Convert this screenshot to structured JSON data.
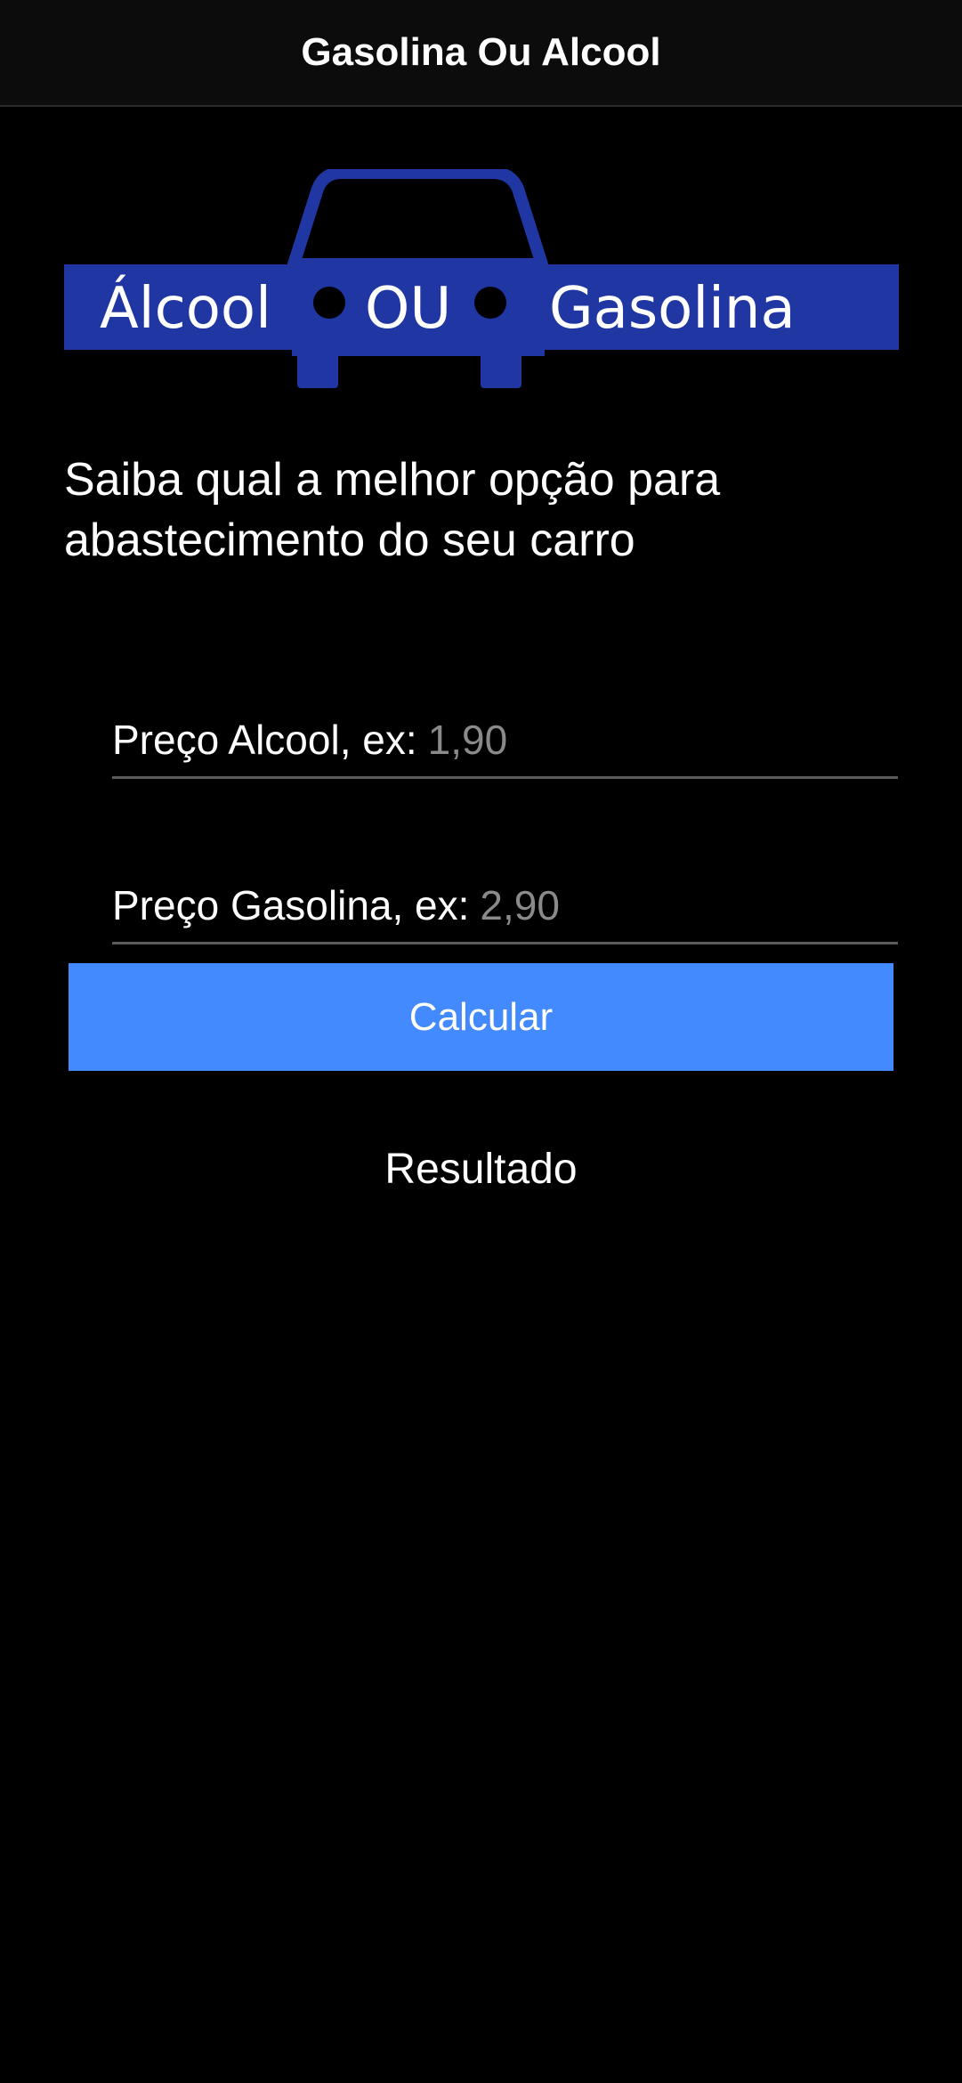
{
  "app_bar": {
    "title": "Gasolina Ou Alcool"
  },
  "logo": {
    "left_text": "Álcool",
    "middle_text": "OU",
    "right_text": "Gasolina",
    "color": "#1f36a3",
    "icon": "car-icon"
  },
  "headline": "Saiba qual a melhor opção para abastecimento do seu carro",
  "form": {
    "alcool": {
      "label": "Preço Alcool, ex:",
      "placeholder": "1,90",
      "value": ""
    },
    "gasolina": {
      "label": "Preço Gasolina, ex:",
      "placeholder": "2,90",
      "value": ""
    }
  },
  "button": {
    "label": "Calcular",
    "color": "#448aff"
  },
  "result": "Resultado",
  "colors": {
    "background": "#000000",
    "app_bar": "#0c0c0c",
    "text": "#ffffff",
    "placeholder": "#8a8a8a"
  }
}
